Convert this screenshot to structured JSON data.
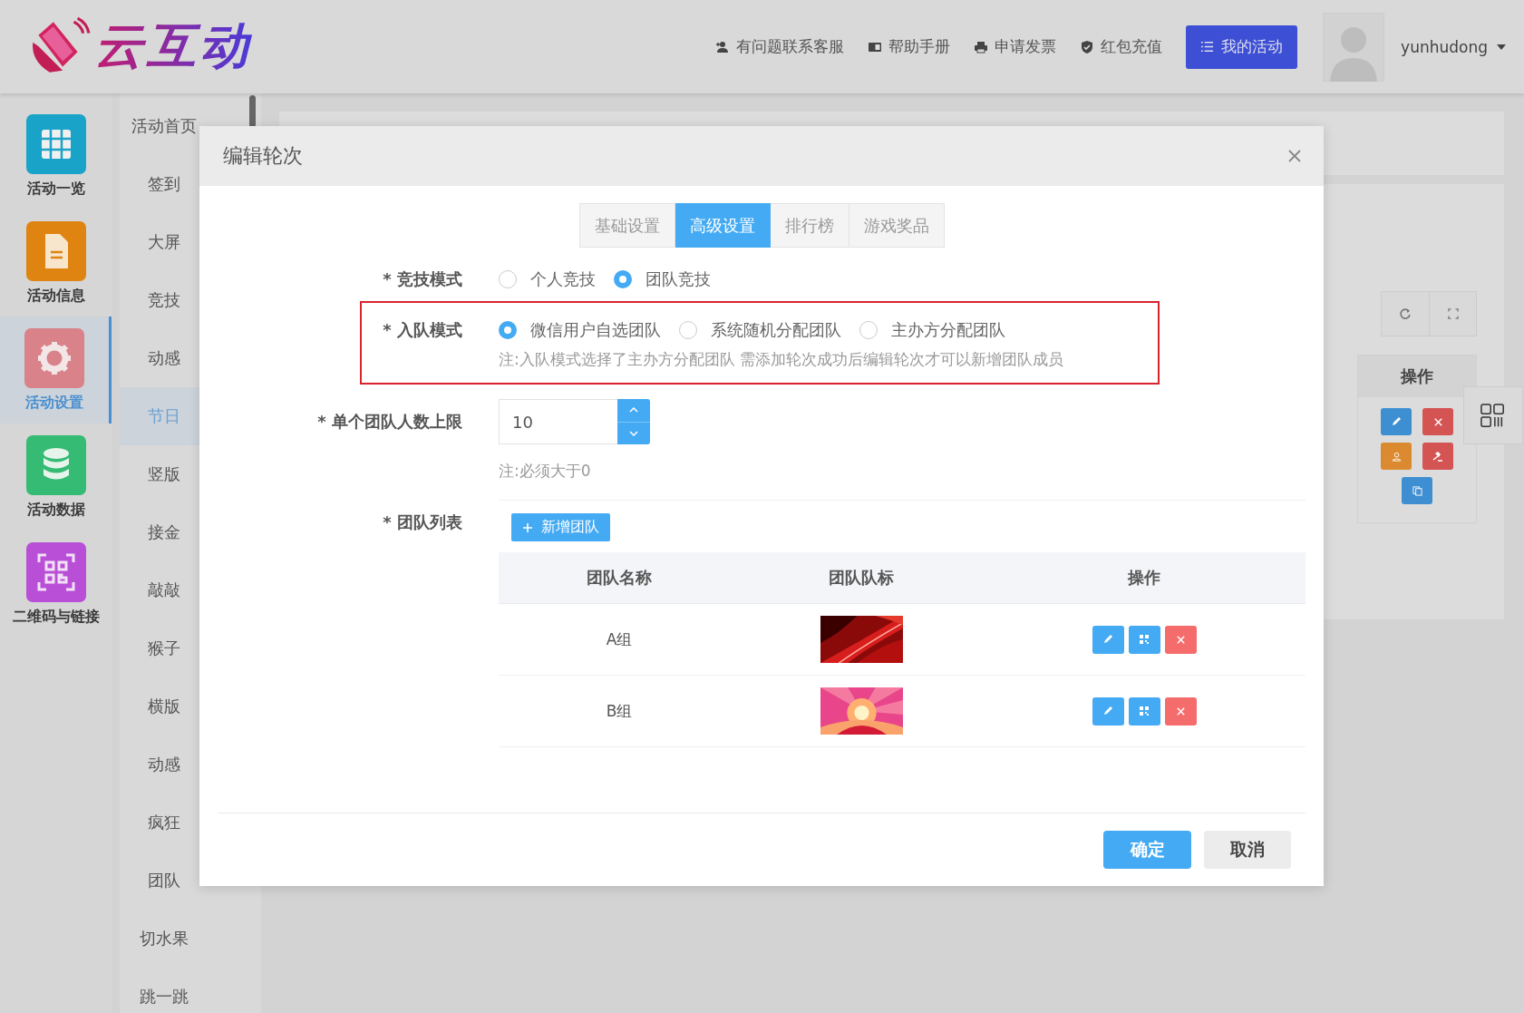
{
  "header": {
    "logo_text": "云互动",
    "links": [
      {
        "label": "有问题联系客服",
        "kind": "contact"
      },
      {
        "label": "帮助手册",
        "kind": "book"
      },
      {
        "label": "申请发票",
        "kind": "printer"
      },
      {
        "label": "红包充值",
        "kind": "shield"
      }
    ],
    "primary_button": "我的活动",
    "username": "yunhudong"
  },
  "sidebar": {
    "items": [
      {
        "label": "活动一览",
        "kind": "grid",
        "color": "#1aa3c8",
        "selected": false
      },
      {
        "label": "活动信息",
        "kind": "document",
        "color": "#df8410",
        "selected": false
      },
      {
        "label": "活动设置",
        "kind": "gear",
        "color": "#d9828a",
        "selected": true
      },
      {
        "label": "活动数据",
        "kind": "database",
        "color": "#35bb73",
        "selected": false
      },
      {
        "label": "二维码与链接",
        "kind": "qrcode",
        "color": "#b94fd6",
        "selected": false
      }
    ]
  },
  "submenu": {
    "items": [
      {
        "label": "活动首页",
        "selected": false
      },
      {
        "label": "签到",
        "selected": false
      },
      {
        "label": "大屏",
        "selected": false
      },
      {
        "label": "竞技",
        "selected": false
      },
      {
        "label": "动感",
        "selected": false
      },
      {
        "label": "节日",
        "selected": true
      },
      {
        "label": "竖版",
        "selected": false
      },
      {
        "label": "接金",
        "selected": false
      },
      {
        "label": "敲敲",
        "selected": false
      },
      {
        "label": "猴子",
        "selected": false
      },
      {
        "label": "横版",
        "selected": false
      },
      {
        "label": "动感",
        "selected": false
      },
      {
        "label": "疯狂",
        "selected": false
      },
      {
        "label": "团队",
        "selected": false
      },
      {
        "label": "切水果",
        "selected": false
      },
      {
        "label": "跳一跳",
        "selected": false
      }
    ]
  },
  "background": {
    "column_header": "操作"
  },
  "dialog": {
    "title": "编辑轮次",
    "tabs": [
      {
        "label": "基础设置",
        "selected": false
      },
      {
        "label": "高级设置",
        "selected": true
      },
      {
        "label": "排行榜",
        "selected": false
      },
      {
        "label": "游戏奖品",
        "selected": false
      }
    ],
    "compete_mode": {
      "label": "* 竞技模式",
      "options": [
        {
          "label": "个人竞技",
          "selected": false
        },
        {
          "label": "团队竞技",
          "selected": true
        }
      ]
    },
    "join_mode": {
      "label": "* 入队模式",
      "highlighted": true,
      "options": [
        {
          "label": "微信用户自选团队",
          "selected": true
        },
        {
          "label": "系统随机分配团队",
          "selected": false
        },
        {
          "label": "主办方分配团队",
          "selected": false
        }
      ],
      "note": "注:入队模式选择了主办方分配团队 需添加轮次成功后编辑轮次才可以新增团队成员"
    },
    "team_size": {
      "label": "* 单个团队人数上限",
      "value": "10",
      "note": "注:必须大于0"
    },
    "team_list": {
      "label": "* 团队列表",
      "add_button": "新增团队",
      "columns": [
        "团队名称",
        "团队队标",
        "操作"
      ],
      "rows": [
        {
          "name": "A组"
        },
        {
          "name": "B组"
        }
      ]
    },
    "confirm_button": "确定",
    "cancel_button": "取消"
  }
}
